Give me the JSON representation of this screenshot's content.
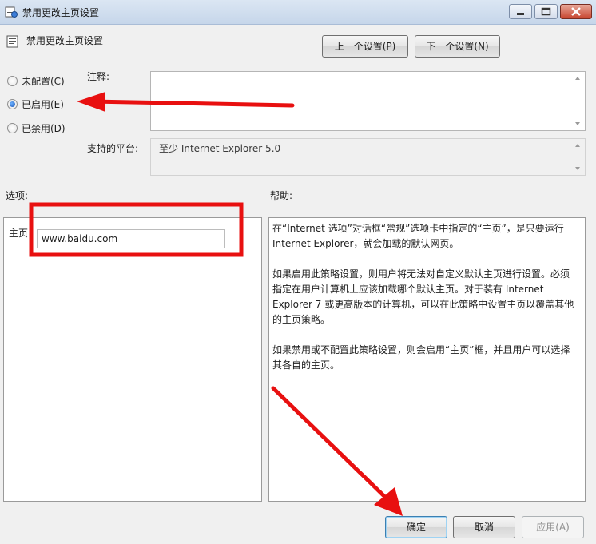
{
  "window": {
    "title": "禁用更改主页设置",
    "minimize": "minimize-icon",
    "maximize": "maximize-icon",
    "close": "close-icon"
  },
  "header": {
    "title": "禁用更改主页设置"
  },
  "nav": {
    "prev_label": "上一个设置(P)",
    "next_label": "下一个设置(N)"
  },
  "state": {
    "options": [
      {
        "label": "未配置(C)",
        "selected": false
      },
      {
        "label": "已启用(E)",
        "selected": true
      },
      {
        "label": "已禁用(D)",
        "selected": false
      }
    ]
  },
  "comment": {
    "label": "注释:",
    "value": ""
  },
  "platform": {
    "label": "支持的平台:",
    "value": "至少 Internet Explorer 5.0"
  },
  "options_panel": {
    "heading": "选项:",
    "homepage_label": "主页",
    "homepage_value": "www.baidu.com"
  },
  "help_panel": {
    "heading": "帮助:",
    "paragraphs": [
      "在“Internet 选项”对话框“常规”选项卡中指定的“主页”，是只要运行 Internet Explorer，就会加载的默认网页。",
      "如果启用此策略设置，则用户将无法对自定义默认主页进行设置。必须指定在用户计算机上应该加载哪个默认主页。对于装有 Internet Explorer 7 或更高版本的计算机，可以在此策略中设置主页以覆盖其他的主页策略。",
      "如果禁用或不配置此策略设置，则会启用“主页”框，并且用户可以选择其各自的主页。"
    ]
  },
  "footer": {
    "ok_label": "确定",
    "cancel_label": "取消",
    "apply_label": "应用(A)"
  },
  "colors": {
    "annotation_red": "#e81010",
    "title_bar": "#c6d6ea",
    "dialog_bg": "#f0f0f0"
  }
}
